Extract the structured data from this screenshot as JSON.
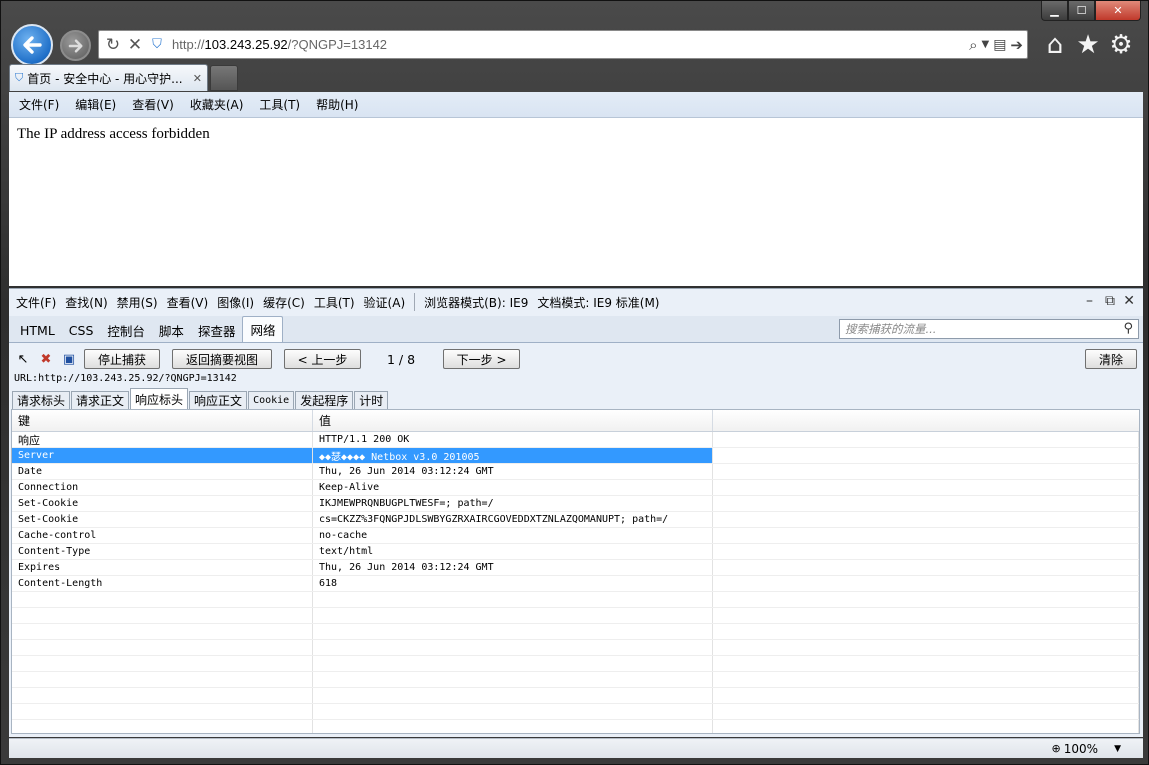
{
  "window": {
    "min": "▁",
    "max": "☐",
    "close": "✕"
  },
  "address": {
    "prefix": "http://",
    "host": "103.243.25.92",
    "path": "/?QNGPJ=13142"
  },
  "tab": {
    "title": "首页 - 安全中心 - 用心守护...",
    "close": "✕"
  },
  "menu": [
    "文件(F)",
    "编辑(E)",
    "查看(V)",
    "收藏夹(A)",
    "工具(T)",
    "帮助(H)"
  ],
  "page": {
    "text": "The IP address access forbidden"
  },
  "devtools": {
    "menu": [
      "文件(F)",
      "查找(N)",
      "禁用(S)",
      "查看(V)",
      "图像(I)",
      "缓存(C)",
      "工具(T)",
      "验证(A)"
    ],
    "browser_mode": "浏览器模式(B): IE9",
    "doc_mode": "文档模式: IE9 标准(M)",
    "tabs": [
      "HTML",
      "CSS",
      "控制台",
      "脚本",
      "探查器",
      "网络"
    ],
    "active_tab": "网络",
    "search_placeholder": "搜索捕获的流量...",
    "buttons": {
      "stop": "停止捕获",
      "back_summary": "返回摘要视图",
      "prev": "< 上一步",
      "next": "下一步 >",
      "clear": "清除"
    },
    "counter": "1 / 8",
    "url_line": "URL:http://103.243.25.92/?QNGPJ=13142",
    "sub_tabs": [
      "请求标头",
      "请求正文",
      "响应标头",
      "响应正文",
      "Cookie",
      "发起程序",
      "计时"
    ],
    "active_sub_tab": "响应标头",
    "columns": [
      "键",
      "值"
    ],
    "rows": [
      {
        "key": "响应",
        "value": "HTTP/1.1 200 OK"
      },
      {
        "key": "Server",
        "value": "◆◆瑟◆◆◆◆ Netbox v3.0 201005"
      },
      {
        "key": "Date",
        "value": "Thu, 26 Jun 2014 03:12:24 GMT"
      },
      {
        "key": "Connection",
        "value": "Keep-Alive"
      },
      {
        "key": "Set-Cookie",
        "value": "IKJMEWPRQNBUGPLTWESF=; path=/"
      },
      {
        "key": "Set-Cookie",
        "value": "cs=CKZZ%3FQNGPJDLSWBYGZRXAIRCGOVEDDXTZNLAZQOMANUPT; path=/"
      },
      {
        "key": "Cache-control",
        "value": "no-cache"
      },
      {
        "key": "Content-Type",
        "value": "text/html"
      },
      {
        "key": "Expires",
        "value": "Thu, 26 Jun 2014 03:12:24 GMT"
      },
      {
        "key": "Content-Length",
        "value": "618"
      }
    ],
    "selected_row": 1,
    "empty_rows": 9
  },
  "status": {
    "zoom": "100%",
    "zoom_icon": "zoom-icon"
  },
  "colors": {
    "selection": "#3399ff",
    "menu_bg": "#e3ecf7"
  }
}
